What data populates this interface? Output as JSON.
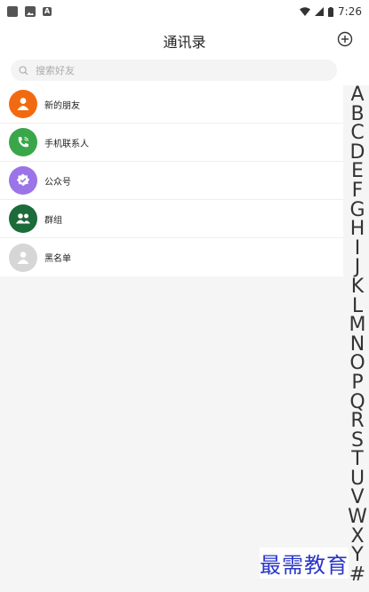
{
  "status_bar": {
    "left_icons": [
      "square-icon",
      "image-icon",
      "a-icon"
    ],
    "a_icon_letter": "A",
    "time": "7:26"
  },
  "header": {
    "title": "通讯录",
    "add_icon": "plus-circle-icon"
  },
  "search": {
    "placeholder": "搜索好友",
    "value": ""
  },
  "list": [
    {
      "label": "新的朋友",
      "icon": "new-friend-icon",
      "color": "#f26a0f"
    },
    {
      "label": "手机联系人",
      "icon": "phone-contacts-icon",
      "color": "#3aa64a"
    },
    {
      "label": "公众号",
      "icon": "official-account-icon",
      "color": "#9b74e8"
    },
    {
      "label": "群组",
      "icon": "group-icon",
      "color": "#1c6b3a"
    },
    {
      "label": "黑名单",
      "icon": "blacklist-icon",
      "color": "#d6d6d6"
    }
  ],
  "alphabet": [
    "A",
    "B",
    "C",
    "D",
    "E",
    "F",
    "G",
    "H",
    "I",
    "J",
    "K",
    "L",
    "M",
    "N",
    "O",
    "P",
    "Q",
    "R",
    "S",
    "T",
    "U",
    "V",
    "W",
    "X",
    "Y",
    "#"
  ],
  "watermark": "最需教育"
}
